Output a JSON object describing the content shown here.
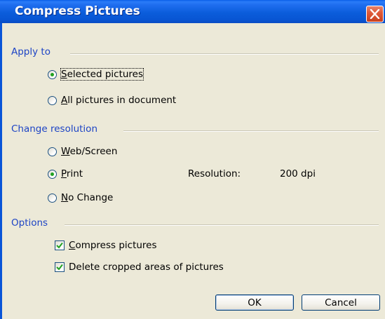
{
  "window": {
    "title": "Compress Pictures",
    "close_icon": "close-x-icon"
  },
  "apply_to": {
    "legend": "Apply to",
    "options": [
      {
        "label": "Selected pictures",
        "selected": true
      },
      {
        "label": "All pictures in document",
        "selected": false
      }
    ]
  },
  "change_resolution": {
    "legend": "Change resolution",
    "options": [
      {
        "label": "Web/Screen",
        "selected": false
      },
      {
        "label": "Print",
        "selected": true
      },
      {
        "label": "No Change",
        "selected": false
      }
    ],
    "resolution_label": "Resolution:",
    "resolution_value": "200 dpi"
  },
  "options_group": {
    "legend": "Options",
    "checkboxes": [
      {
        "label": "Compress pictures",
        "checked": true
      },
      {
        "label": "Delete cropped areas of pictures",
        "checked": true
      }
    ]
  },
  "buttons": {
    "ok": "OK",
    "cancel": "Cancel"
  },
  "colors": {
    "titlebar": "#0855d3",
    "group_label": "#1d44c5",
    "dialog_bg": "#ece9d8",
    "radio_dot": "#21a121",
    "check_mark": "#21a121"
  }
}
